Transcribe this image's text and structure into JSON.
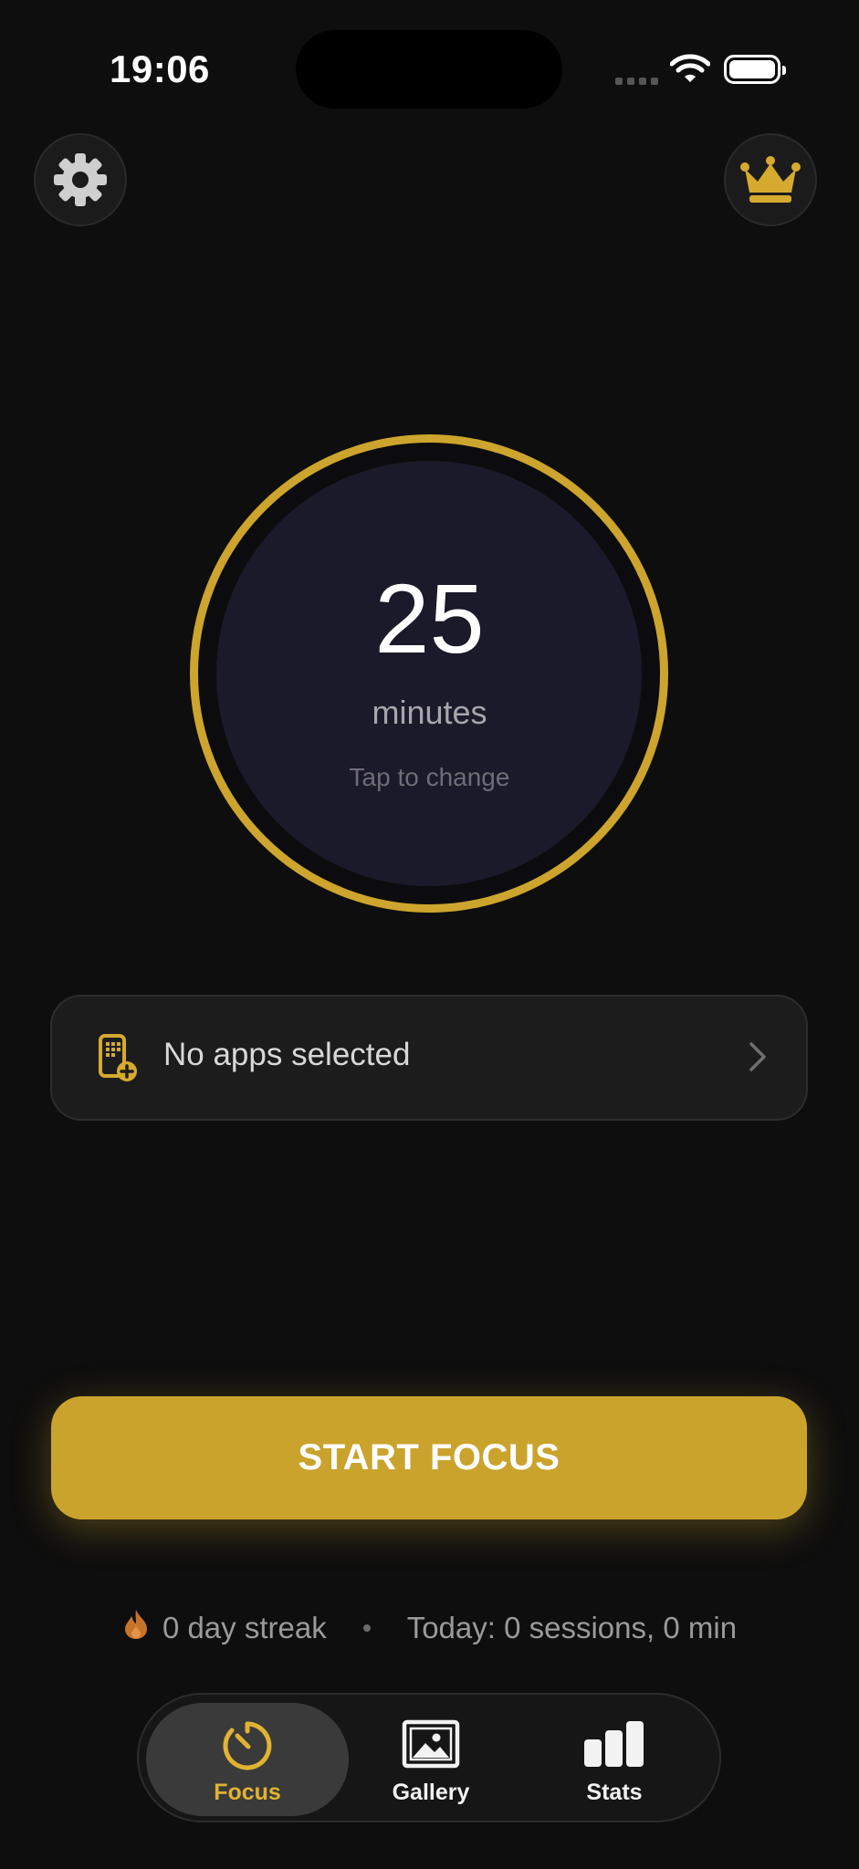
{
  "status_bar": {
    "time": "19:06"
  },
  "timer": {
    "minutes": "25",
    "unit_label": "minutes",
    "hint": "Tap to change"
  },
  "apps": {
    "label": "No apps selected"
  },
  "start_button": {
    "label": "START FOCUS"
  },
  "stats": {
    "streak": "0 day streak",
    "today": "Today: 0 sessions, 0 min"
  },
  "tabs": [
    {
      "label": "Focus",
      "icon": "timer-icon",
      "active": true
    },
    {
      "label": "Gallery",
      "icon": "image-icon",
      "active": false
    },
    {
      "label": "Stats",
      "icon": "bar-chart-icon",
      "active": false
    }
  ],
  "colors": {
    "accent": "#c9a32c",
    "background": "#0e0e0e",
    "dial": "#1b1a2a"
  }
}
